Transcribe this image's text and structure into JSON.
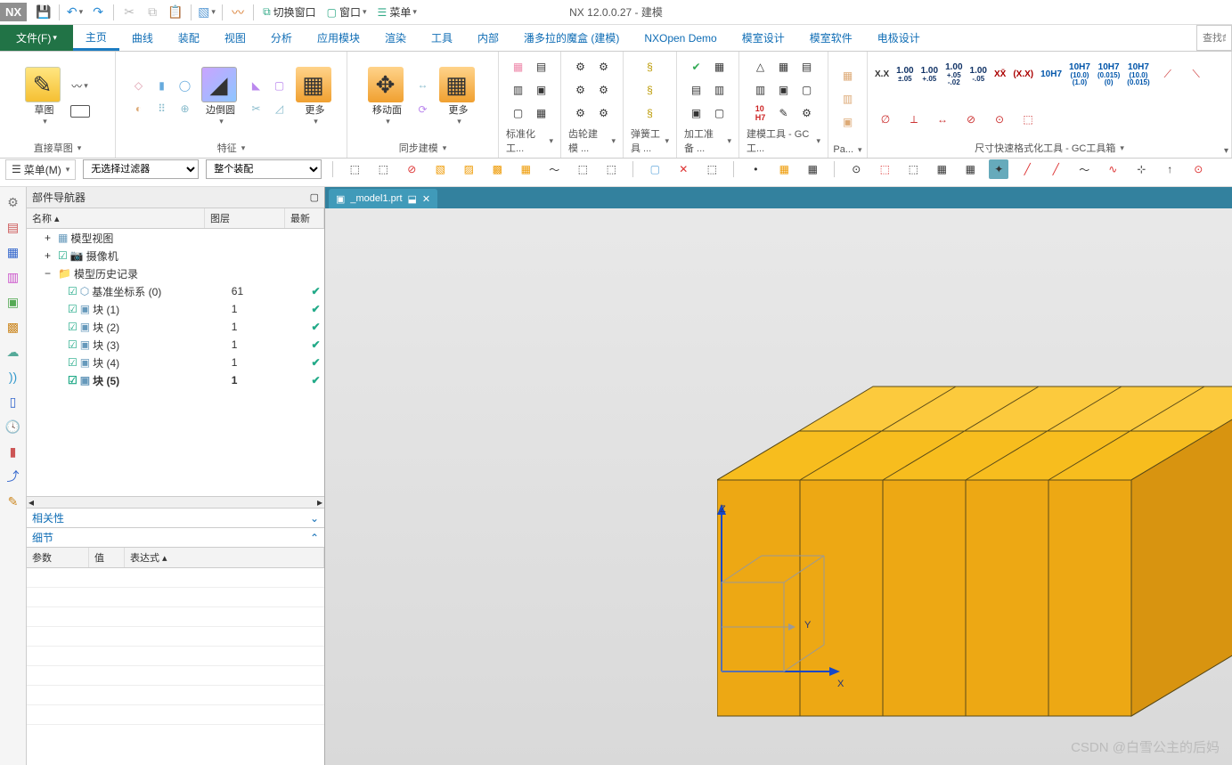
{
  "app": {
    "title": "NX 12.0.0.27 - 建模",
    "logo": "NX"
  },
  "titlebar": {
    "switch_window": "切换窗口",
    "window": "窗口",
    "menu": "菜单"
  },
  "menubar": {
    "file": "文件(F)",
    "items": [
      "主页",
      "曲线",
      "装配",
      "视图",
      "分析",
      "应用模块",
      "渲染",
      "工具",
      "内部",
      "潘多拉的魔盒 (建模)",
      "NXOpen Demo",
      "模室设计",
      "模室软件",
      "电极设计"
    ],
    "active_index": 0,
    "search_placeholder": "查找命"
  },
  "ribbon": {
    "groups": [
      {
        "label": "直接草图",
        "buttons": [
          "草图"
        ]
      },
      {
        "label": "特征",
        "buttons": [
          "边倒圆",
          "更多"
        ]
      },
      {
        "label": "同步建模",
        "buttons": [
          "移动面",
          "更多"
        ]
      },
      {
        "label": "标准化工..."
      },
      {
        "label": "齿轮建模 ..."
      },
      {
        "label": "弹簧工具 ..."
      },
      {
        "label": "加工准备 ..."
      },
      {
        "label": "建模工具 - GC工..."
      },
      {
        "label": "Pa..."
      },
      {
        "label": "尺寸快速格式化工具 - GC工具箱"
      }
    ],
    "dim_cells": [
      {
        "t": "X.X"
      },
      {
        "t": "1.00",
        "s": "±.05",
        "c": "#136"
      },
      {
        "t": "1.00",
        "s": "+.05",
        "c": "#136"
      },
      {
        "t": "1.00",
        "s": "+.05",
        "u": "-.02",
        "c": "#136"
      },
      {
        "t": "1.00",
        "s": "",
        "u": "-.05",
        "c": "#136"
      },
      {
        "t": "XX̄",
        "c": "#a00"
      },
      {
        "t": "(X.X)",
        "c": "#a00"
      },
      {
        "t": "10H7",
        "c": "#05a"
      },
      {
        "t": "10H7",
        "s": "(10.0)",
        "u": "(1.0)",
        "c": "#05a"
      },
      {
        "t": "10H7",
        "s": "(0.015)",
        "u": "(0)",
        "c": "#05a"
      },
      {
        "t": "10H7",
        "s": "(10.0)",
        "u": "(0.015)",
        "c": "#05a"
      }
    ]
  },
  "selbar": {
    "menu_btn": "菜单(M)",
    "filter1": "无选择过滤器",
    "filter2": "整个装配"
  },
  "navigator": {
    "title": "部件导航器",
    "columns": {
      "name": "名称",
      "layer": "图层",
      "new": "最新"
    },
    "tree": [
      {
        "lvl": 0,
        "exp": "+",
        "icon": "model-view-icon",
        "label": "模型视图"
      },
      {
        "lvl": 0,
        "exp": "+",
        "icon": "camera-icon",
        "label": "摄像机",
        "chk": true
      },
      {
        "lvl": 0,
        "exp": "−",
        "icon": "folder-icon",
        "label": "模型历史记录"
      },
      {
        "lvl": 1,
        "chk": true,
        "icon": "csys-icon",
        "label": "基准坐标系 (0)",
        "layer": "61",
        "ok": true
      },
      {
        "lvl": 1,
        "chk": true,
        "icon": "block-icon",
        "label": "块 (1)",
        "layer": "1",
        "ok": true
      },
      {
        "lvl": 1,
        "chk": true,
        "icon": "block-icon",
        "label": "块 (2)",
        "layer": "1",
        "ok": true
      },
      {
        "lvl": 1,
        "chk": true,
        "icon": "block-icon",
        "label": "块 (3)",
        "layer": "1",
        "ok": true
      },
      {
        "lvl": 1,
        "chk": true,
        "icon": "block-icon",
        "label": "块 (4)",
        "layer": "1",
        "ok": true
      },
      {
        "lvl": 1,
        "chk": true,
        "icon": "block-icon",
        "label": "块 (5)",
        "layer": "1",
        "ok": true,
        "bold": true
      }
    ],
    "dependency_title": "相关性",
    "details_title": "细节",
    "detail_cols": {
      "param": "参数",
      "value": "值",
      "expr": "表达式"
    }
  },
  "viewport": {
    "file_tab": "_model1.prt",
    "axes": {
      "x": "X",
      "y": "Y",
      "z": "Z"
    }
  },
  "watermark": "CSDN @白雪公主的后妈"
}
